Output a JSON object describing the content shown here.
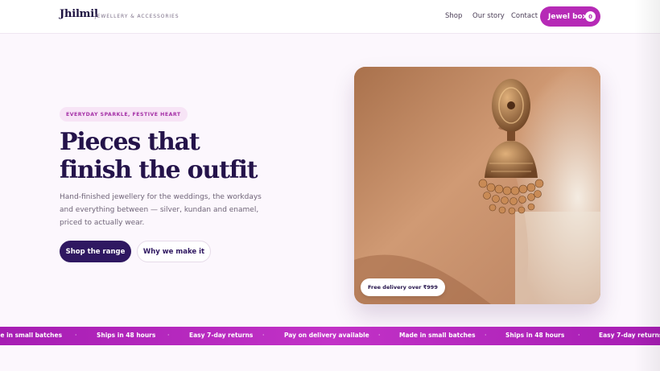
{
  "brand": {
    "logo": "Jhilmil",
    "tagline": "JEWELLERY & ACCESSORIES",
    "accent_color": "#b62ab6",
    "primary_color": "#2f1861"
  },
  "nav": {
    "links": [
      "Shop",
      "Our story",
      "Contact"
    ],
    "cart_label": "Jewel box",
    "cart_count": "0"
  },
  "hero": {
    "eyebrow": "EVERYDAY SPARKLE, FESTIVE HEART",
    "title_line1": "Pieces that",
    "title_line2": "finish the outfit",
    "description": "Hand-finished jewellery for the weddings, the workdays and everything between — silver, kundan and enamel, priced to actually wear.",
    "primary_cta": "Shop the range",
    "secondary_cta": "Why we make it",
    "image_badge": "Free delivery over ₹999"
  },
  "marquee": {
    "items": [
      "de in small batches",
      "Ships in 48 hours",
      "Easy 7-day returns",
      "Pay on delivery available",
      "Made in small batches",
      "Ships in 48 hours",
      "Easy 7-day returns"
    ],
    "separator": "·"
  },
  "icons": {
    "hero_image": "jhumka-earring-photo"
  }
}
